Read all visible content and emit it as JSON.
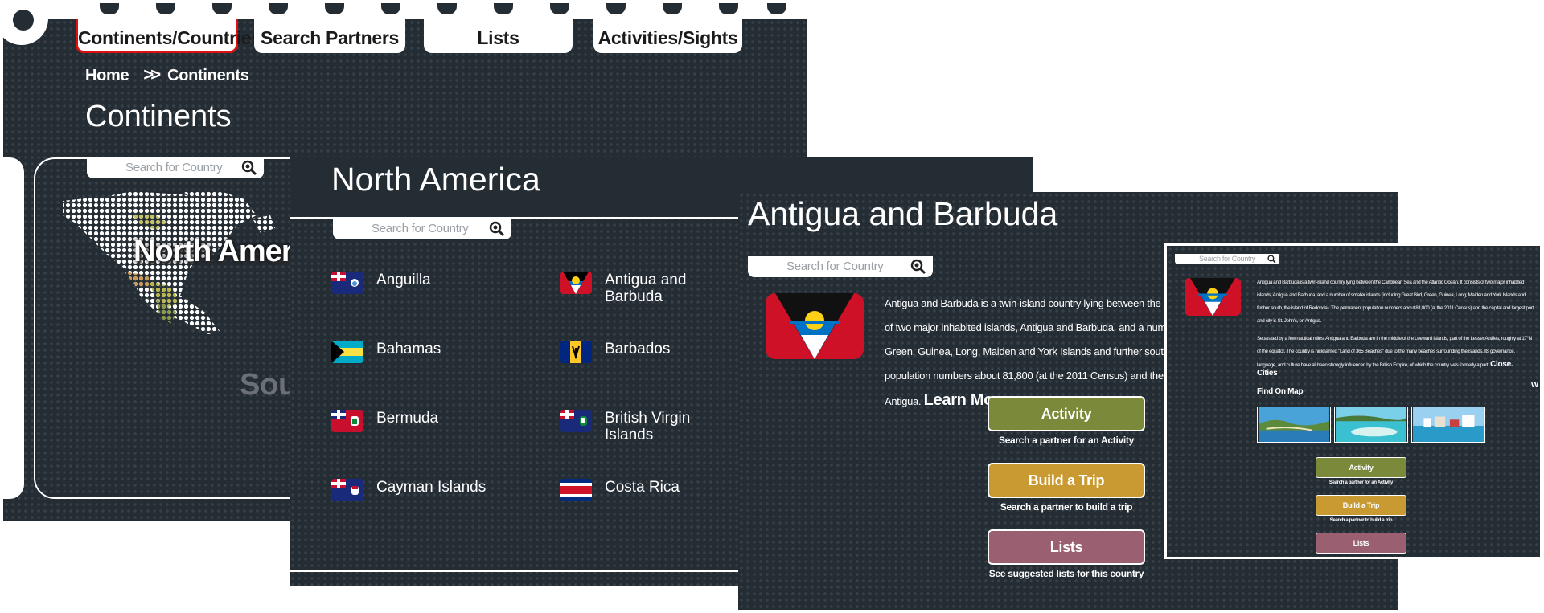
{
  "nav": {
    "tabs": [
      {
        "label": "Continents/Countries",
        "active": true
      },
      {
        "label": "Search Partners",
        "active": false
      },
      {
        "label": "Lists",
        "active": false
      },
      {
        "label": "Activities/Sights",
        "active": false
      }
    ]
  },
  "breadcrumb": {
    "home": "Home",
    "separator": ">>",
    "current": "Continents"
  },
  "continents_page": {
    "title": "Continents",
    "search_placeholder": "Search for Country",
    "map_labels": {
      "highlighted": "North America",
      "partial": "South Amer"
    }
  },
  "region_page": {
    "title": "North America",
    "search_placeholder": "Search for Country",
    "countries": [
      {
        "name": "Anguilla",
        "flag": "anguilla-flag"
      },
      {
        "name": "Antigua and Barbuda",
        "flag": "antigua-barbuda-flag"
      },
      {
        "name": "Bahamas",
        "flag": "bahamas-flag"
      },
      {
        "name": "Barbados",
        "flag": "barbados-flag"
      },
      {
        "name": "Bermuda",
        "flag": "bermuda-flag"
      },
      {
        "name": "British Virgin Islands",
        "flag": "bvi-flag"
      },
      {
        "name": "Cayman Islands",
        "flag": "cayman-flag"
      },
      {
        "name": "Costa Rica",
        "flag": "costa-rica-flag"
      }
    ]
  },
  "country_page": {
    "title": "Antigua and Barbuda",
    "search_placeholder": "Search for Country",
    "description": "Antigua and Barbuda is a twin-island country lying between the Caribbean Sea and the Atlantic Ocean. It consists of two major inhabited islands, Antigua and Barbuda, and a number of smaller islands (including Great Bird, Green, Guinea, Long, Maiden and York Islands and further south, the island of Redonda). The permanent population numbers about 81,800 (at the 2011 Census) and the capital and largest port and city is St. John's, on Antigua.",
    "learn_more": "Learn More...",
    "actions": [
      {
        "label": "Activity",
        "sub": "Search a partner for an Activity",
        "color": "#7a8a3a"
      },
      {
        "label": "Build a Trip",
        "sub": "Search a partner to build a trip",
        "color": "#c99a32"
      },
      {
        "label": "Lists",
        "sub": "See suggested lists for this country",
        "color": "#9a5f70"
      }
    ]
  },
  "country_expanded": {
    "search_placeholder": "Search for Country",
    "paragraph1": "Antigua and Barbuda is a twin-island country lying between the Caribbean Sea and the Atlantic Ocean. It consists of two major inhabited islands, Antigua and Barbuda, and a number of smaller islands (including Great Bird, Green, Guinea, Long, Maiden and York Islands and further south, the island of Redonda). The permanent population numbers about 81,800 (at the 2011 Census) and the capital and largest port and city is St. John's, on Antigua.",
    "paragraph2": "Separated by a few nautical miles, Antigua and Barbuda are in the middle of the Leeward Islands, part of the Lesser Antilles, roughly at 17°N of the equator. The country is nicknamed \"Land of 365 Beaches\" due to the many beaches surrounding the islands. Its governance, language, and culture have all been strongly influenced by the British Empire, of which the country was formerly a part.",
    "close": "Close.",
    "cities_label": "Cities",
    "find_on_map_label": "Find On Map",
    "edge_letter": "W",
    "actions": [
      {
        "label": "Activity",
        "sub": "Search a partner for an Activity"
      },
      {
        "label": "Build a Trip",
        "sub": "Search a partner to build a trip"
      },
      {
        "label": "Lists",
        "sub": "See suggested lists for this country"
      }
    ]
  },
  "colors": {
    "background": "#242c34",
    "activity": "#7a8a3a",
    "build_trip": "#c99a32",
    "lists": "#9a5f70",
    "active_tab_outline": "#dd1111"
  }
}
